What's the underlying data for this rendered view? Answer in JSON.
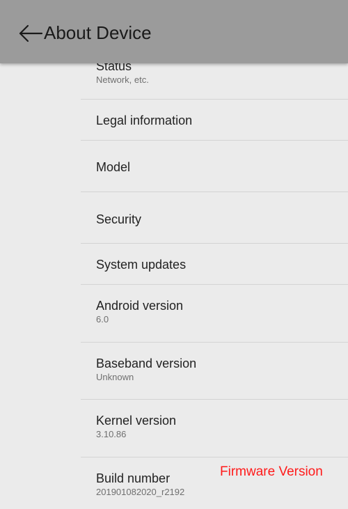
{
  "header": {
    "title": "About Device",
    "back_icon": "arrow-left-icon"
  },
  "items": [
    {
      "label": "Status",
      "value": "Network, etc."
    },
    {
      "label": "Legal information",
      "value": ""
    },
    {
      "label": "Model",
      "value": ""
    },
    {
      "label": "Security",
      "value": ""
    },
    {
      "label": "System updates",
      "value": ""
    },
    {
      "label": "Android version",
      "value": "6.0"
    },
    {
      "label": "Baseband version",
      "value": "Unknown"
    },
    {
      "label": "Kernel version",
      "value": "3.10.86"
    },
    {
      "label": "Build number",
      "value": "201901082020_r2192"
    }
  ],
  "annotation": {
    "text": "Firmware Version",
    "color": "#ff1a1a"
  },
  "colors": {
    "appbar": "#9b9b9b",
    "background": "#ebebeb",
    "divider": "#d3d3d3"
  }
}
